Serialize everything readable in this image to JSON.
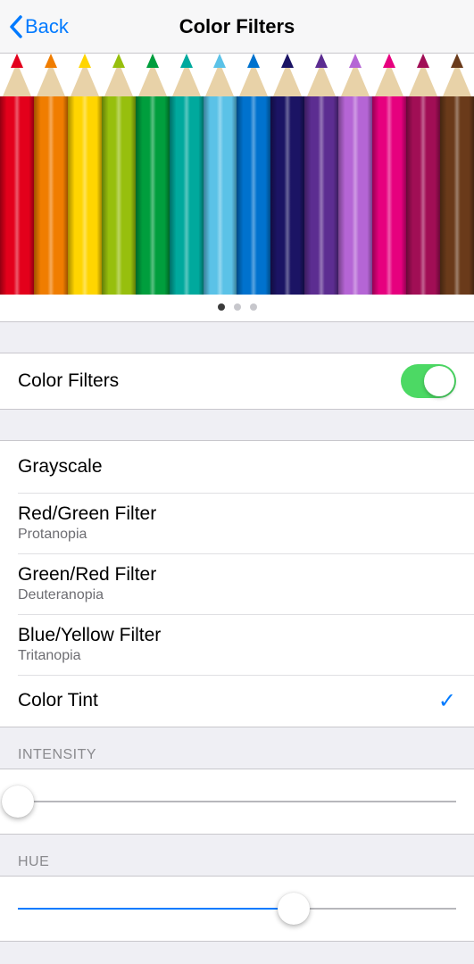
{
  "nav": {
    "back_label": "Back",
    "title": "Color Filters"
  },
  "preview": {
    "pencil_colors": [
      "#e3001b",
      "#f07d00",
      "#ffd500",
      "#97bf0d",
      "#009e3d",
      "#00a99d",
      "#5bc2e7",
      "#0072ce",
      "#1b1464",
      "#5c2d91",
      "#b565d5",
      "#e6007e",
      "#a10e55",
      "#6a3a1a"
    ],
    "page_count": 3,
    "active_page": 0
  },
  "toggle": {
    "label": "Color Filters",
    "on": true
  },
  "filters": [
    {
      "title": "Grayscale",
      "subtitle": "",
      "checked": false
    },
    {
      "title": "Red/Green Filter",
      "subtitle": "Protanopia",
      "checked": false
    },
    {
      "title": "Green/Red Filter",
      "subtitle": "Deuteranopia",
      "checked": false
    },
    {
      "title": "Blue/Yellow Filter",
      "subtitle": "Tritanopia",
      "checked": false
    },
    {
      "title": "Color Tint",
      "subtitle": "",
      "checked": true
    }
  ],
  "sliders": {
    "intensity": {
      "header": "INTENSITY",
      "percent": 0
    },
    "hue": {
      "header": "HUE",
      "percent": 63
    }
  }
}
